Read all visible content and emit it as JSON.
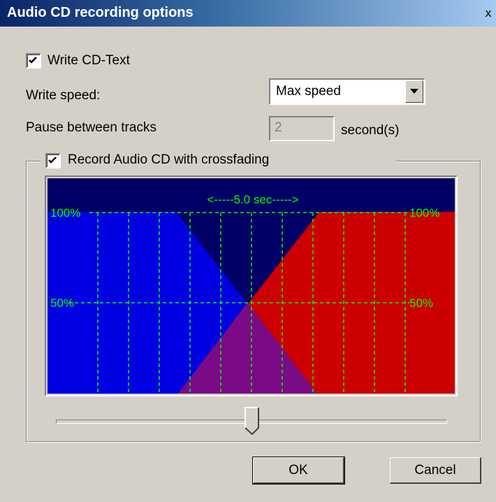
{
  "window": {
    "title": "Audio CD recording options",
    "close_label": "x"
  },
  "options": {
    "write_cdtext": {
      "label": "Write CD-Text",
      "checked": true
    },
    "write_speed": {
      "label": "Write speed:",
      "value": "Max speed"
    },
    "pause": {
      "label": "Pause between tracks",
      "value": "2",
      "unit": "second(s)"
    },
    "crossfade": {
      "label": "Record Audio CD with crossfading",
      "checked": true
    }
  },
  "graph": {
    "duration_label": "<-----5.0 sec----->",
    "left_top_label": "100%",
    "left_mid_label": "50%",
    "right_top_label": "100%",
    "right_mid_label": "50%",
    "colors": {
      "background": "#000066",
      "left": "#0000e0",
      "right": "#cc0000",
      "overlap": "#7a0a85",
      "grid": "#00ff00"
    }
  },
  "slider": {
    "position_fraction": 0.5
  },
  "buttons": {
    "ok": "OK",
    "cancel": "Cancel"
  }
}
